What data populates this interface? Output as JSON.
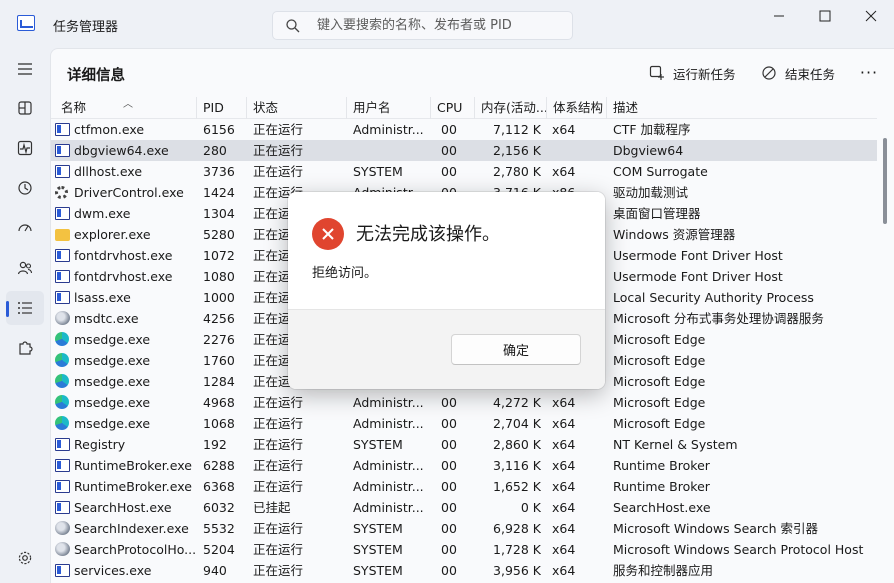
{
  "window": {
    "title": "任务管理器",
    "search_placeholder": "键入要搜索的名称、发布者或 PID"
  },
  "nav": {
    "items": [
      "hamburger-menu",
      "processes",
      "performance",
      "app-history",
      "startup-apps",
      "users",
      "details",
      "services",
      "settings"
    ],
    "active": "details"
  },
  "page": {
    "title": "详细信息",
    "run_new_task": "运行新任务",
    "end_task": "结束任务",
    "more": "···"
  },
  "table": {
    "headers": {
      "name": "名称",
      "pid": "PID",
      "status": "状态",
      "user": "用户名",
      "cpu": "CPU",
      "memory": "内存(活动...",
      "arch": "体系结构",
      "desc": "描述"
    },
    "rows": [
      {
        "icon": "window",
        "name": "ctfmon.exe",
        "pid": "6156",
        "status": "正在运行",
        "user": "Administr...",
        "cpu": "00",
        "mem": "7,112 K",
        "arch": "x64",
        "desc": "CTF 加载程序"
      },
      {
        "icon": "window",
        "name": "dbgview64.exe",
        "pid": "280",
        "status": "正在运行",
        "user": "",
        "cpu": "00",
        "mem": "2,156 K",
        "arch": "",
        "desc": "Dbgview64",
        "selected": true
      },
      {
        "icon": "window",
        "name": "dllhost.exe",
        "pid": "3736",
        "status": "正在运行",
        "user": "SYSTEM",
        "cpu": "00",
        "mem": "2,780 K",
        "arch": "x64",
        "desc": "COM Surrogate"
      },
      {
        "icon": "gear",
        "name": "DriverControl.exe",
        "pid": "1424",
        "status": "正在运行",
        "user": "Administr...",
        "cpu": "00",
        "mem": "3,716 K",
        "arch": "x86",
        "desc": "驱动加载测试"
      },
      {
        "icon": "window",
        "name": "dwm.exe",
        "pid": "1304",
        "status": "正在运行",
        "user": "",
        "cpu": "",
        "mem": "",
        "arch": "",
        "desc": "桌面窗口管理器"
      },
      {
        "icon": "folder",
        "name": "explorer.exe",
        "pid": "5280",
        "status": "正在运行",
        "user": "",
        "cpu": "",
        "mem": "",
        "arch": "",
        "desc": "Windows 资源管理器"
      },
      {
        "icon": "window",
        "name": "fontdrvhost.exe",
        "pid": "1072",
        "status": "正在运行",
        "user": "",
        "cpu": "",
        "mem": "",
        "arch": "",
        "desc": "Usermode Font Driver Host"
      },
      {
        "icon": "window",
        "name": "fontdrvhost.exe",
        "pid": "1080",
        "status": "正在运行",
        "user": "",
        "cpu": "",
        "mem": "",
        "arch": "",
        "desc": "Usermode Font Driver Host"
      },
      {
        "icon": "window",
        "name": "lsass.exe",
        "pid": "1000",
        "status": "正在运行",
        "user": "",
        "cpu": "",
        "mem": "",
        "arch": "",
        "desc": "Local Security Authority Process"
      },
      {
        "icon": "service",
        "name": "msdtc.exe",
        "pid": "4256",
        "status": "正在运行",
        "user": "",
        "cpu": "",
        "mem": "",
        "arch": "",
        "desc": "Microsoft 分布式事务处理协调器服务"
      },
      {
        "icon": "edge",
        "name": "msedge.exe",
        "pid": "2276",
        "status": "正在运行",
        "user": "",
        "cpu": "",
        "mem": "",
        "arch": "",
        "desc": "Microsoft Edge"
      },
      {
        "icon": "edge",
        "name": "msedge.exe",
        "pid": "1760",
        "status": "正在运行",
        "user": "",
        "cpu": "",
        "mem": "",
        "arch": "",
        "desc": "Microsoft Edge"
      },
      {
        "icon": "edge",
        "name": "msedge.exe",
        "pid": "1284",
        "status": "正在运行",
        "user": "",
        "cpu": "",
        "mem": "",
        "arch": "",
        "desc": "Microsoft Edge"
      },
      {
        "icon": "edge",
        "name": "msedge.exe",
        "pid": "4968",
        "status": "正在运行",
        "user": "Administr...",
        "cpu": "00",
        "mem": "4,272 K",
        "arch": "x64",
        "desc": "Microsoft Edge"
      },
      {
        "icon": "edge",
        "name": "msedge.exe",
        "pid": "1068",
        "status": "正在运行",
        "user": "Administr...",
        "cpu": "00",
        "mem": "2,704 K",
        "arch": "x64",
        "desc": "Microsoft Edge"
      },
      {
        "icon": "window",
        "name": "Registry",
        "pid": "192",
        "status": "正在运行",
        "user": "SYSTEM",
        "cpu": "00",
        "mem": "2,860 K",
        "arch": "x64",
        "desc": "NT Kernel & System"
      },
      {
        "icon": "window",
        "name": "RuntimeBroker.exe",
        "pid": "6288",
        "status": "正在运行",
        "user": "Administr...",
        "cpu": "00",
        "mem": "3,116 K",
        "arch": "x64",
        "desc": "Runtime Broker"
      },
      {
        "icon": "window",
        "name": "RuntimeBroker.exe",
        "pid": "6368",
        "status": "正在运行",
        "user": "Administr...",
        "cpu": "00",
        "mem": "1,652 K",
        "arch": "x64",
        "desc": "Runtime Broker"
      },
      {
        "icon": "window",
        "name": "SearchHost.exe",
        "pid": "6032",
        "status": "已挂起",
        "user": "Administr...",
        "cpu": "00",
        "mem": "0 K",
        "arch": "x64",
        "desc": "SearchHost.exe"
      },
      {
        "icon": "service",
        "name": "SearchIndexer.exe",
        "pid": "5532",
        "status": "正在运行",
        "user": "SYSTEM",
        "cpu": "00",
        "mem": "6,928 K",
        "arch": "x64",
        "desc": "Microsoft Windows Search 索引器"
      },
      {
        "icon": "service",
        "name": "SearchProtocolHo...",
        "pid": "5204",
        "status": "正在运行",
        "user": "SYSTEM",
        "cpu": "00",
        "mem": "1,728 K",
        "arch": "x64",
        "desc": "Microsoft Windows Search Protocol Host"
      },
      {
        "icon": "window",
        "name": "services.exe",
        "pid": "940",
        "status": "正在运行",
        "user": "SYSTEM",
        "cpu": "00",
        "mem": "3,956 K",
        "arch": "x64",
        "desc": "服务和控制器应用"
      }
    ]
  },
  "dialog": {
    "title": "无法完成该操作。",
    "message": "拒绝访问。",
    "ok_label": "确定"
  },
  "colors": {
    "accent": "#2a5bd7",
    "error": "#e0452f",
    "selected_row": "#dcdfe5"
  }
}
